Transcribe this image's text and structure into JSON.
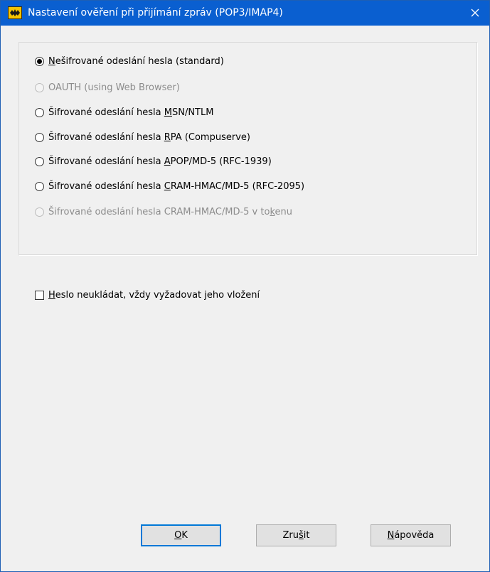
{
  "window": {
    "title": "Nastavení ověření při přijímání zpráv (POP3/IMAP4)"
  },
  "auth_options": [
    {
      "pre": "",
      "ul": "N",
      "post": "ešifrované odeslání hesla (standard)",
      "checked": true,
      "enabled": true
    },
    {
      "pre": "OAUTH (using Web Browser)",
      "ul": "",
      "post": "",
      "checked": false,
      "enabled": false
    },
    {
      "pre": "Šifrované odeslání hesla ",
      "ul": "M",
      "post": "SN/NTLM",
      "checked": false,
      "enabled": true
    },
    {
      "pre": "Šifrované odeslání hesla ",
      "ul": "R",
      "post": "PA (Compuserve)",
      "checked": false,
      "enabled": true
    },
    {
      "pre": "Šifrované odeslání hesla ",
      "ul": "A",
      "post": "POP/MD-5 (RFC-1939)",
      "checked": false,
      "enabled": true
    },
    {
      "pre": "Šifrované odeslání hesla ",
      "ul": "C",
      "post": "RAM-HMAC/MD-5 (RFC-2095)",
      "checked": false,
      "enabled": true
    },
    {
      "pre": "Šifrované odeslání hesla CRAM-HMAC/MD-5 v to",
      "ul": "k",
      "post": "enu",
      "checked": false,
      "enabled": false
    }
  ],
  "password_checkbox": {
    "ul": "H",
    "post": "eslo neukládat, vždy vyžadovat jeho vložení",
    "checked": false
  },
  "buttons": {
    "ok": {
      "ul": "O",
      "post": "K"
    },
    "cancel": {
      "pre": "Zru",
      "ul": "š",
      "post": "it"
    },
    "help": {
      "ul": "N",
      "post": "ápověda"
    }
  }
}
